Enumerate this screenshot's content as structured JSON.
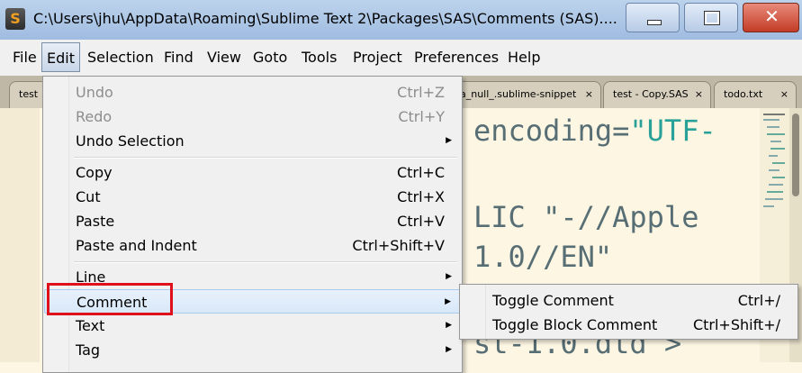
{
  "window": {
    "title": "C:\\Users\\jhu\\AppData\\Roaming\\Sublime Text 2\\Packages\\SAS\\Comments (SAS)....",
    "app_icon": "S",
    "close_glyph": "✕"
  },
  "menubar": [
    "File",
    "Edit",
    "Selection",
    "Find",
    "View",
    "Goto",
    "Tools",
    "Project",
    "Preferences",
    "Help"
  ],
  "tabs": [
    {
      "label": "test",
      "close": ""
    },
    {
      "label": "a_null_.sublime-snippet",
      "close": "×"
    },
    {
      "label": "test - Copy.SAS",
      "close": "×"
    },
    {
      "label": "todo.txt",
      "close": "×"
    }
  ],
  "editor": {
    "lines": [
      {
        "text": "encoding=\"UTF-",
        "colored": true
      },
      {
        "text": "LIC \"-//Apple",
        "colored": false
      },
      {
        "text": "1.0//EN\"",
        "colored": false
      },
      {
        "text": "st-1.0.dtd >",
        "colored": false
      }
    ],
    "colors": {
      "text": "#586e75",
      "string": "#2aa198",
      "background": "#fdf6e3"
    }
  },
  "edit_menu": {
    "groups": [
      [
        {
          "label": "Undo",
          "shortcut": "Ctrl+Z",
          "disabled": true,
          "submenu": false
        },
        {
          "label": "Redo",
          "shortcut": "Ctrl+Y",
          "disabled": true,
          "submenu": false
        },
        {
          "label": "Undo Selection",
          "shortcut": "",
          "disabled": false,
          "submenu": true
        }
      ],
      [
        {
          "label": "Copy",
          "shortcut": "Ctrl+C",
          "disabled": false,
          "submenu": false
        },
        {
          "label": "Cut",
          "shortcut": "Ctrl+X",
          "disabled": false,
          "submenu": false
        },
        {
          "label": "Paste",
          "shortcut": "Ctrl+V",
          "disabled": false,
          "submenu": false
        },
        {
          "label": "Paste and Indent",
          "shortcut": "Ctrl+Shift+V",
          "disabled": false,
          "submenu": false
        }
      ],
      [
        {
          "label": "Line",
          "shortcut": "",
          "disabled": false,
          "submenu": true
        },
        {
          "label": "Comment",
          "shortcut": "",
          "disabled": false,
          "submenu": true,
          "highlighted": true
        },
        {
          "label": "Text",
          "shortcut": "",
          "disabled": false,
          "submenu": true
        },
        {
          "label": "Tag",
          "shortcut": "",
          "disabled": false,
          "submenu": true
        }
      ]
    ],
    "submenu_arrow": "▶"
  },
  "comment_submenu": [
    {
      "label": "Toggle Comment",
      "shortcut": "Ctrl+/"
    },
    {
      "label": "Toggle Block Comment",
      "shortcut": "Ctrl+Shift+/"
    }
  ],
  "annotation_color": "#e0101a"
}
